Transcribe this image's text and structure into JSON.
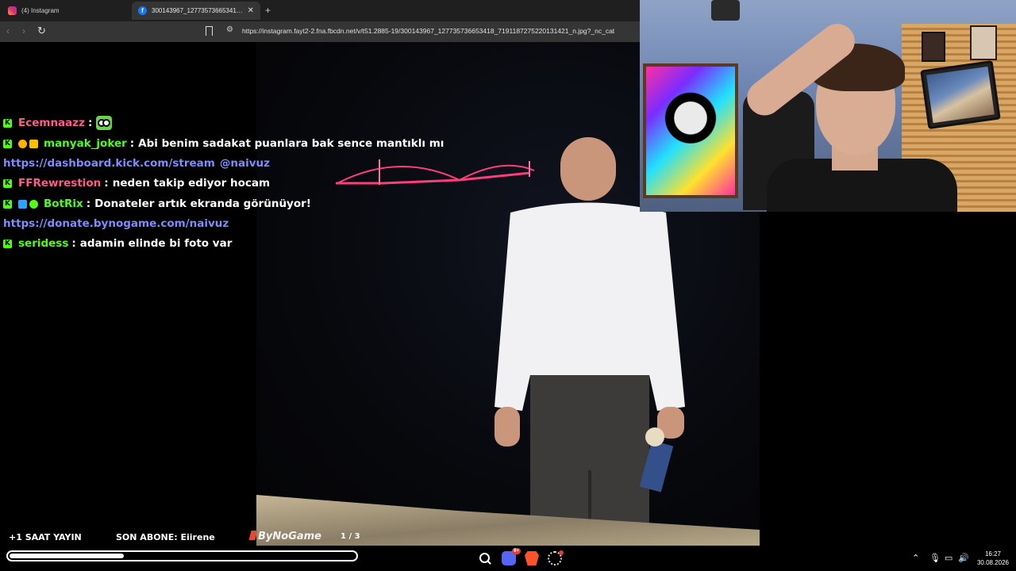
{
  "browser": {
    "tabs": [
      {
        "title": "(4) Instagram",
        "icon": "instagram-icon"
      },
      {
        "title": "300143967_127735736653418_7",
        "icon": "facebook-icon"
      }
    ],
    "address": "https://instagram.fayt2-2.fna.fbcdn.net/v/t51.2885-19/300143967_127735736653418_7191187275220131421_n.jpg?_nc_cat"
  },
  "chat": [
    {
      "user": "Ecemnaazz",
      "color": "#ff5c8a",
      "text": "",
      "emote": "frog-emote"
    },
    {
      "user": "manyak_joker",
      "color": "#53fc18",
      "text": "Abi benim sadakat puanlara bak sence mantıklı mı"
    },
    {
      "link": "https://dashboard.kick.com/stream",
      "mention": "@naivuz"
    },
    {
      "user": "FFRewrestion",
      "color": "#ff5c8a",
      "text": "neden takip ediyor hocam"
    },
    {
      "user": "BotRix",
      "color": "#53fc18",
      "text": "Donateler artık ekranda görünüyor!"
    },
    {
      "link": "https://donate.bynogame.com/naivuz"
    },
    {
      "user": "seridess",
      "color": "#53fc18",
      "text": "adamin elinde bi foto var"
    }
  ],
  "overlay": {
    "saat": "+1 SAAT YAYIN",
    "abone": "SON ABONE: Eiirene",
    "brand": "ByNoGame",
    "pager": "1 / 3",
    "progress": 0.33
  },
  "taskbar": {
    "discord_badge": "9+",
    "time": "16:27",
    "date": "30.08.2026"
  }
}
